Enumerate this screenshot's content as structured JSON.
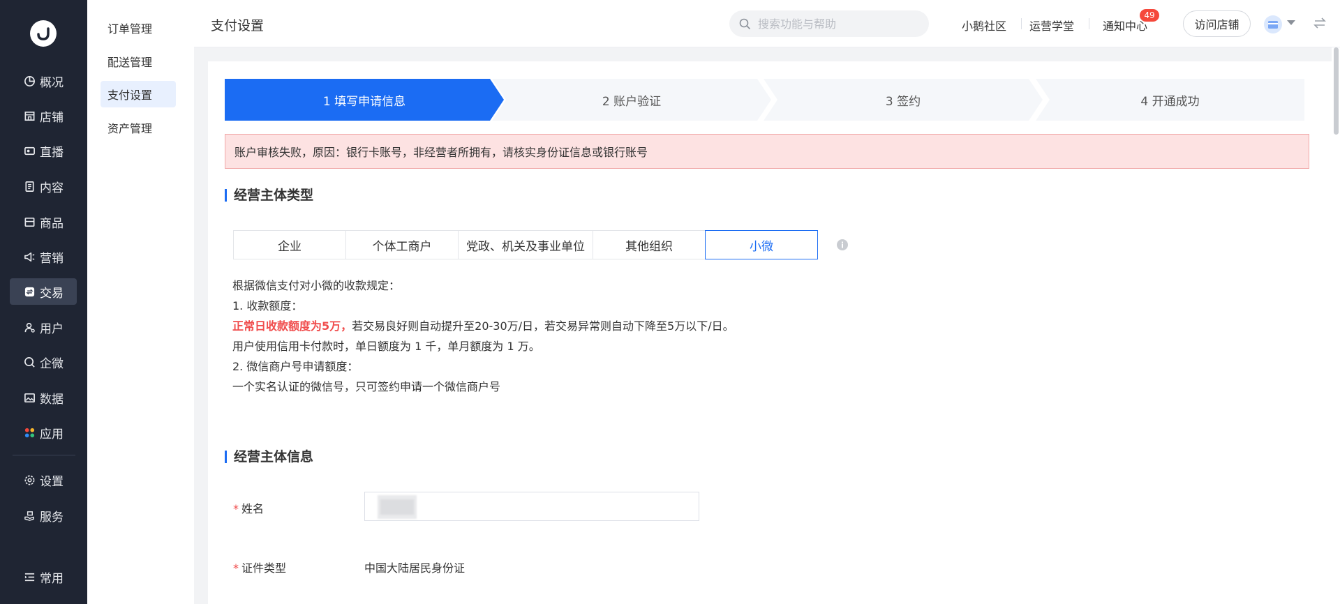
{
  "nav": {
    "items": [
      {
        "label": "概况",
        "icon": "pie-chart-icon"
      },
      {
        "label": "店铺",
        "icon": "store-icon"
      },
      {
        "label": "直播",
        "icon": "live-icon"
      },
      {
        "label": "内容",
        "icon": "document-icon"
      },
      {
        "label": "商品",
        "icon": "box-icon"
      },
      {
        "label": "营销",
        "icon": "megaphone-icon"
      },
      {
        "label": "交易",
        "icon": "exchange-icon"
      },
      {
        "label": "用户",
        "icon": "user-icon"
      },
      {
        "label": "企微",
        "icon": "chat-icon"
      },
      {
        "label": "数据",
        "icon": "image-icon"
      },
      {
        "label": "应用",
        "icon": "apps-icon"
      },
      {
        "label": "设置",
        "icon": "gear-icon"
      },
      {
        "label": "服务",
        "icon": "service-icon"
      },
      {
        "label": "常用",
        "icon": "list-icon"
      }
    ],
    "active": "交易"
  },
  "subnav": {
    "items": [
      "订单管理",
      "配送管理",
      "支付设置",
      "资产管理"
    ],
    "active": "支付设置"
  },
  "header": {
    "title": "支付设置",
    "search_placeholder": "搜索功能与帮助",
    "links": [
      "小鹅社区",
      "运营学堂",
      "通知中心"
    ],
    "notification_count": "49",
    "visit_button": "访问店铺"
  },
  "steps": [
    "1 填写申请信息",
    "2 账户验证",
    "3 签约",
    "4 开通成功"
  ],
  "active_step": 1,
  "alert": "账户审核失败，原因：银行卡账号，非经营者所拥有，请核实身份证信息或银行账号",
  "section1": {
    "title": "经营主体类型",
    "tabs": [
      "企业",
      "个体工商户",
      "党政、机关及事业单位",
      "其他组织",
      "小微"
    ],
    "active_tab": "小微"
  },
  "description": {
    "line1": "根据微信支付对小微的收款规定：",
    "line2": "1. 收款额度：",
    "line3_red": "正常日收款额度为5万，",
    "line3_rest": "若交易良好则自动提升至20-30万/日，若交易异常则自动下降至5万以下/日。",
    "line4": "用户使用信用卡付款时，单日额度为 1 千，单月额度为 1 万。",
    "line5": "2. 微信商户号申请额度：",
    "line6": "一个实名认证的微信号，只可签约申请一个微信商户号"
  },
  "section2": {
    "title": "经营主体信息",
    "name_label": "姓名",
    "id_type_label": "证件类型",
    "id_type_value": "中国大陆居民身份证"
  },
  "colors": {
    "primary": "#1b6cf3",
    "sidebar_bg": "#1f2533",
    "error": "#f04c4c",
    "alert_bg": "#fde2e2"
  }
}
